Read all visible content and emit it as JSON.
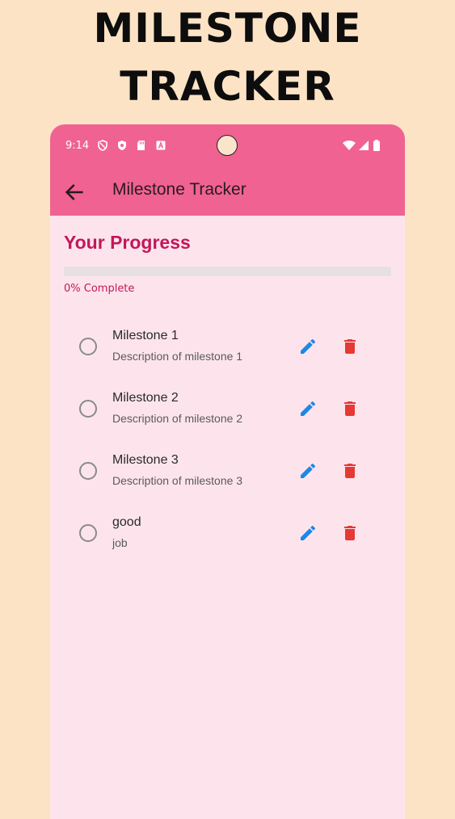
{
  "promo": {
    "line1": "MILESTONE",
    "line2": "TRACKER"
  },
  "status_bar": {
    "time": "9:14"
  },
  "app_bar": {
    "title": "Milestone Tracker"
  },
  "progress": {
    "heading": "Your Progress",
    "percent": 0,
    "label": "0% Complete"
  },
  "milestones": [
    {
      "title": "Milestone 1",
      "description": "Description of milestone 1",
      "completed": false
    },
    {
      "title": "Milestone 2",
      "description": "Description of milestone 2",
      "completed": false
    },
    {
      "title": "Milestone 3",
      "description": "Description of milestone 3",
      "completed": false
    },
    {
      "title": "good",
      "description": "job",
      "completed": false
    }
  ],
  "colors": {
    "page_bg": "#fde3c6",
    "app_bar": "#f06292",
    "accent": "#c2185b",
    "edit_icon": "#1e88e5",
    "delete_icon": "#e53935"
  },
  "icons": [
    "back-arrow-icon",
    "edit-icon",
    "delete-icon",
    "radio-unchecked-icon",
    "wifi-icon",
    "signal-icon",
    "battery-icon"
  ]
}
